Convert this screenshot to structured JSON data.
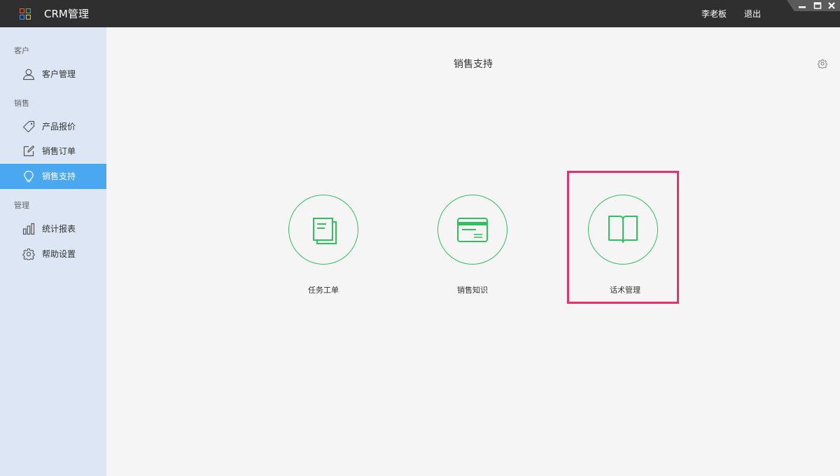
{
  "window": {
    "title": "CRM管理",
    "user_name": "李老板",
    "logout": "退出"
  },
  "sidebar": {
    "sections": [
      {
        "label": "客户",
        "items": [
          {
            "label": "客户管理",
            "icon": "user-icon"
          }
        ]
      },
      {
        "label": "销售",
        "items": [
          {
            "label": "产品报价",
            "icon": "tag-icon"
          },
          {
            "label": "销售订单",
            "icon": "edit-icon"
          },
          {
            "label": "销售支持",
            "icon": "lightbulb-icon",
            "active": true
          }
        ]
      },
      {
        "label": "管理",
        "items": [
          {
            "label": "统计报表",
            "icon": "bar-chart-icon"
          },
          {
            "label": "帮助设置",
            "icon": "gear-icon"
          }
        ]
      }
    ]
  },
  "main": {
    "title": "销售支持",
    "features": [
      {
        "label": "任务工单",
        "icon": "documents-icon"
      },
      {
        "label": "销售知识",
        "icon": "card-icon"
      },
      {
        "label": "话术管理",
        "icon": "book-icon",
        "highlighted": true
      }
    ]
  },
  "colors": {
    "titlebar": "#2f2f2f",
    "sidebar_bg": "#dce6f4",
    "active_item": "#4aa8f0",
    "accent_green": "#2fc060",
    "highlight_border": "#e8306a"
  }
}
